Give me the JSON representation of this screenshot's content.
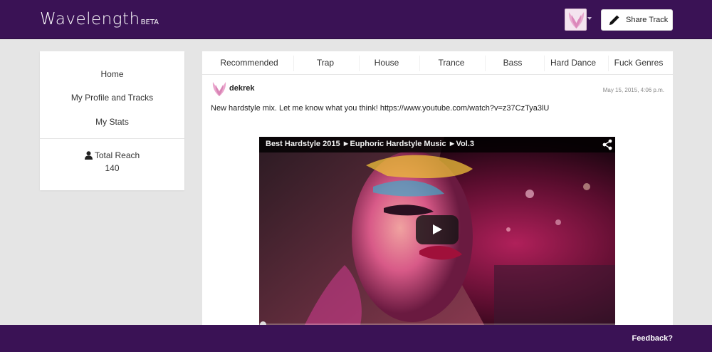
{
  "header": {
    "brand": "Wavelength",
    "brand_badge": "BETA",
    "share_label": "Share Track",
    "accent_color": "#3a1255"
  },
  "sidebar": {
    "items": [
      {
        "label": "Home"
      },
      {
        "label": "My Profile and Tracks"
      },
      {
        "label": "My Stats"
      }
    ],
    "reach_label": "Total Reach",
    "reach_value": "140"
  },
  "tabs": [
    {
      "label": "Recommended"
    },
    {
      "label": "Trap"
    },
    {
      "label": "House"
    },
    {
      "label": "Trance"
    },
    {
      "label": "Bass"
    },
    {
      "label": "Hard Dance"
    },
    {
      "label": "Fuck Genres"
    }
  ],
  "post": {
    "username": "dekrek",
    "timestamp": "May 15, 2015, 4:06 p.m.",
    "text": "New hardstyle mix. Let me know what you think! https://www.youtube.com/watch?v=z37CzTya3lU",
    "video": {
      "title": "Best Hardstyle 2015 ►Euphoric Hardstyle Music ►Vol.3"
    }
  },
  "footer": {
    "feedback_label": "Feedback?"
  }
}
